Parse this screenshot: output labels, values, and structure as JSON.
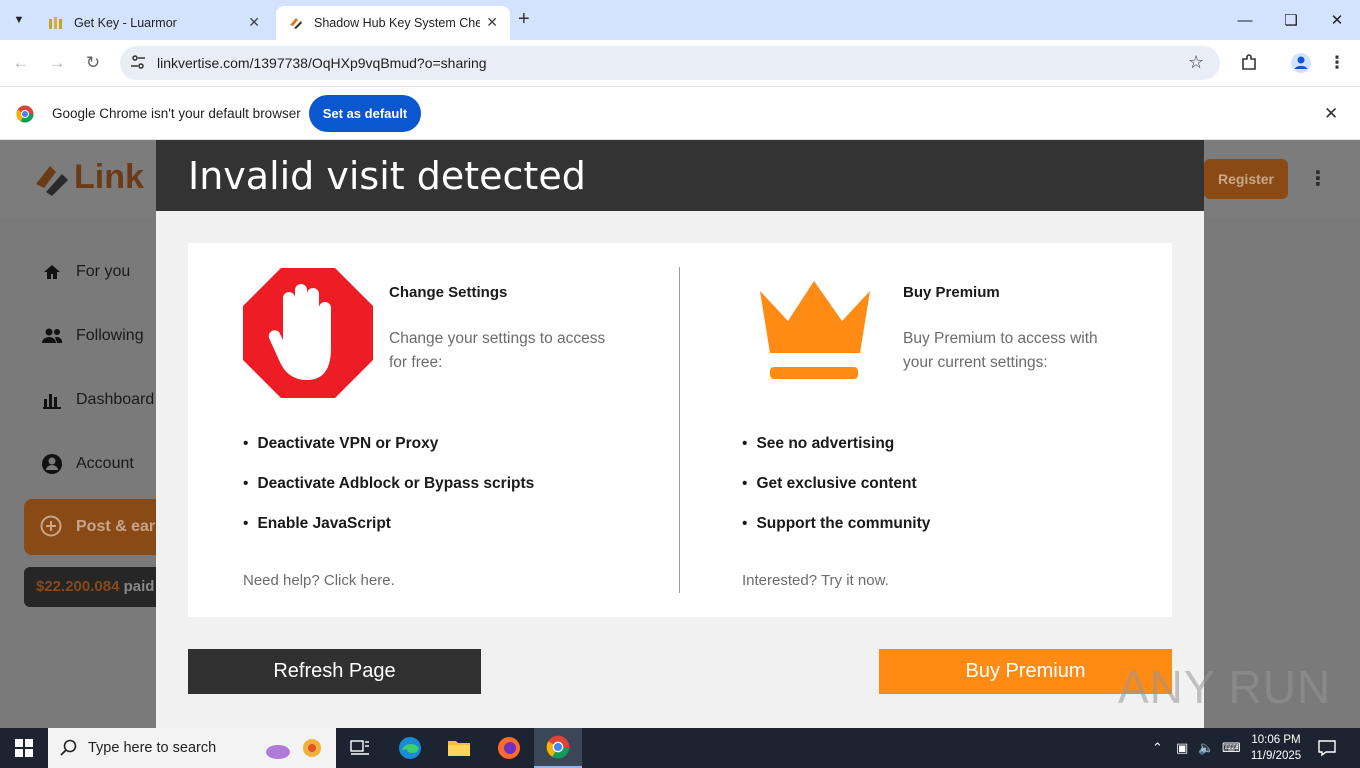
{
  "browser": {
    "tabs": [
      {
        "title": "Get Key - Luarmor",
        "active": false
      },
      {
        "title": "Shadow Hub Key System Check",
        "active": true
      }
    ],
    "url": "linkvertise.com/1397738/OqHXp9vqBmud?o=sharing"
  },
  "infobar": {
    "message": "Google Chrome isn't your default browser",
    "button": "Set as default"
  },
  "site": {
    "logo_text": "Link",
    "register": "Register",
    "sidebar": [
      {
        "label": "For you",
        "icon": "home-icon"
      },
      {
        "label": "Following",
        "icon": "people-icon"
      },
      {
        "label": "Dashboard",
        "icon": "bar-chart-icon"
      },
      {
        "label": "Account",
        "icon": "account-icon"
      }
    ],
    "post_earn": "Post & earn",
    "paid_amount": "$22.200.084",
    "paid_label": "paid"
  },
  "modal": {
    "title": "Invalid visit detected",
    "left": {
      "heading": "Change Settings",
      "description": "Change your settings to access for free:",
      "bullets": [
        "Deactivate VPN or Proxy",
        "Deactivate Adblock or Bypass scripts",
        "Enable JavaScript"
      ],
      "footer": "Need help? Click here."
    },
    "right": {
      "heading": "Buy Premium",
      "description": "Buy Premium to access with your current settings:",
      "bullets": [
        "See no advertising",
        "Get exclusive content",
        "Support the community"
      ],
      "footer": "Interested? Try it now."
    },
    "refresh_button": "Refresh Page",
    "premium_button": "Buy Premium"
  },
  "watermark": "ANY RUN",
  "taskbar": {
    "search_placeholder": "Type here to search",
    "time": "10:06 PM",
    "date": "11/9/2025"
  },
  "colors": {
    "accent_orange": "#ff8a14",
    "stop_red": "#ee1c25",
    "chrome_blue": "#0b57d0"
  }
}
